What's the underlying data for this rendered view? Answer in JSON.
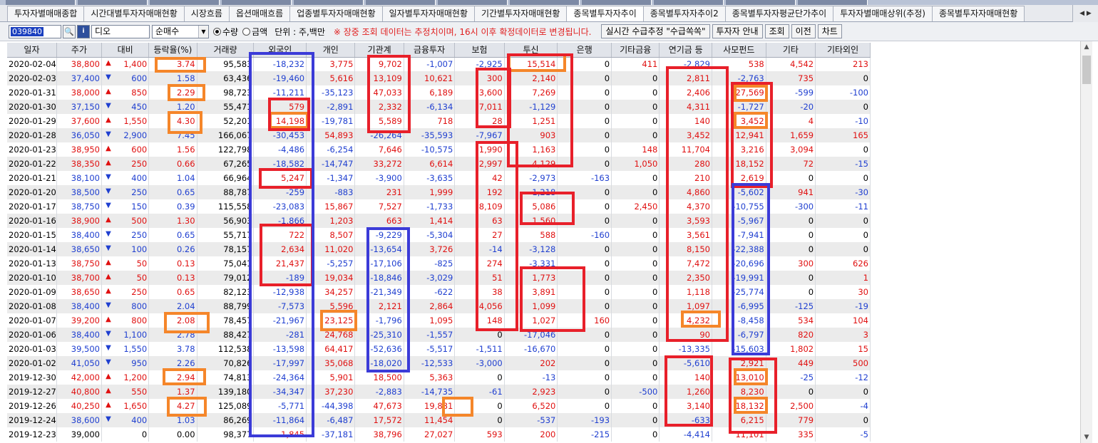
{
  "tabs": [
    "투자자별매매종합",
    "시간대별투자자매매현황",
    "시장흐름",
    "옵션매매흐름",
    "업종별투자자매매현황",
    "일자별투자자매매현황",
    "기간별투자자매매현황",
    "종목별투자자추이",
    "종목별투자자추이2",
    "종목별투자자평균단가추이",
    "투자자별매매상위(추정)",
    "종목별투자자매매현황"
  ],
  "toolbar": {
    "code": "039840",
    "name": "디오",
    "select": "순매수",
    "radio_qty": "수량",
    "radio_amt": "금액",
    "unit": "단위 : 주,백만",
    "notice": "※ 장중 조회 데이터는 추정치이며, 16시 이후 확정데이터로 변경됩니다.",
    "btn_realtime": "실시간 수급추정 \"수급쏙쏙\"",
    "btn_guide": "투자자 안내",
    "btn_query": "조회",
    "btn_prev": "이전",
    "btn_chart": "차트"
  },
  "headers": [
    "일자",
    "주가",
    "대비",
    "등락율(%)",
    "거래량",
    "외국인",
    "개인",
    "기관계",
    "금융투자",
    "보험",
    "투신",
    "은행",
    "기타금융",
    "연기금 등",
    "사모펀드",
    "기타",
    "기타외인"
  ],
  "rows": [
    [
      "2020-02-04",
      "38,800",
      "up",
      "1,400",
      "3.74",
      "95,583",
      "-18,232",
      "3,775",
      "9,702",
      "-1,007",
      "-2,925",
      "15,514",
      "0",
      "411",
      "-2,829",
      "538",
      "4,542",
      "213"
    ],
    [
      "2020-02-03",
      "37,400",
      "dn",
      "600",
      "1.58",
      "63,436",
      "-19,460",
      "5,616",
      "13,109",
      "10,621",
      "300",
      "2,140",
      "0",
      "0",
      "2,811",
      "-2,763",
      "735",
      "0"
    ],
    [
      "2020-01-31",
      "38,000",
      "up",
      "850",
      "2.29",
      "98,723",
      "-11,211",
      "-35,123",
      "47,033",
      "6,189",
      "3,600",
      "7,269",
      "0",
      "0",
      "2,406",
      "27,569",
      "-599",
      "-100"
    ],
    [
      "2020-01-30",
      "37,150",
      "dn",
      "450",
      "1.20",
      "55,471",
      "579",
      "-2,891",
      "2,332",
      "-6,134",
      "7,011",
      "-1,129",
      "0",
      "0",
      "4,311",
      "-1,727",
      "-20",
      "0"
    ],
    [
      "2020-01-29",
      "37,600",
      "up",
      "1,550",
      "4.30",
      "52,201",
      "14,198",
      "-19,781",
      "5,589",
      "718",
      "28",
      "1,251",
      "0",
      "0",
      "140",
      "3,452",
      "4",
      "-10"
    ],
    [
      "2020-01-28",
      "36,050",
      "dn",
      "2,900",
      "7.45",
      "166,067",
      "-30,453",
      "54,893",
      "-26,264",
      "-35,593",
      "-7,967",
      "903",
      "0",
      "0",
      "3,452",
      "12,941",
      "1,659",
      "165"
    ],
    [
      "2020-01-23",
      "38,950",
      "up",
      "600",
      "1.56",
      "122,798",
      "-4,486",
      "-6,254",
      "7,646",
      "-10,575",
      "1,990",
      "1,163",
      "0",
      "148",
      "11,704",
      "3,216",
      "3,094",
      "0"
    ],
    [
      "2020-01-22",
      "38,350",
      "up",
      "250",
      "0.66",
      "67,265",
      "-18,582",
      "-14,747",
      "33,272",
      "6,614",
      "2,997",
      "4,129",
      "0",
      "1,050",
      "280",
      "18,152",
      "72",
      "-15"
    ],
    [
      "2020-01-21",
      "38,100",
      "dn",
      "400",
      "1.04",
      "66,964",
      "5,247",
      "-1,347",
      "-3,900",
      "-3,635",
      "42",
      "-2,973",
      "-163",
      "0",
      "210",
      "2,619",
      "0",
      "0"
    ],
    [
      "2020-01-20",
      "38,500",
      "dn",
      "250",
      "0.65",
      "88,787",
      "-259",
      "-883",
      "231",
      "1,999",
      "192",
      "-1,218",
      "0",
      "0",
      "4,860",
      "-5,602",
      "941",
      "-30"
    ],
    [
      "2020-01-17",
      "38,750",
      "dn",
      "150",
      "0.39",
      "115,558",
      "-23,083",
      "15,867",
      "7,527",
      "-1,733",
      "8,109",
      "5,086",
      "0",
      "2,450",
      "4,370",
      "-10,755",
      "-300",
      "-11"
    ],
    [
      "2020-01-16",
      "38,900",
      "up",
      "500",
      "1.30",
      "56,903",
      "-1,866",
      "1,203",
      "663",
      "1,414",
      "63",
      "1,560",
      "0",
      "0",
      "3,593",
      "-5,967",
      "0",
      "0"
    ],
    [
      "2020-01-15",
      "38,400",
      "dn",
      "250",
      "0.65",
      "55,717",
      "722",
      "8,507",
      "-9,229",
      "-5,304",
      "27",
      "588",
      "-160",
      "0",
      "3,561",
      "-7,941",
      "0",
      "0"
    ],
    [
      "2020-01-14",
      "38,650",
      "dn",
      "100",
      "0.26",
      "78,157",
      "2,634",
      "11,020",
      "-13,654",
      "3,726",
      "-14",
      "-3,128",
      "0",
      "0",
      "8,150",
      "-22,388",
      "0",
      "0"
    ],
    [
      "2020-01-13",
      "38,750",
      "up",
      "50",
      "0.13",
      "75,041",
      "21,437",
      "-5,257",
      "-17,106",
      "-825",
      "274",
      "-3,331",
      "0",
      "0",
      "7,472",
      "-20,696",
      "300",
      "626"
    ],
    [
      "2020-01-10",
      "38,700",
      "up",
      "50",
      "0.13",
      "79,012",
      "-189",
      "19,034",
      "-18,846",
      "-3,029",
      "51",
      "1,773",
      "0",
      "0",
      "2,350",
      "-19,991",
      "0",
      "1"
    ],
    [
      "2020-01-09",
      "38,650",
      "up",
      "250",
      "0.65",
      "82,123",
      "-12,938",
      "34,257",
      "-21,349",
      "-622",
      "38",
      "3,891",
      "0",
      "0",
      "1,118",
      "-25,774",
      "0",
      "30"
    ],
    [
      "2020-01-08",
      "38,400",
      "dn",
      "800",
      "2.04",
      "88,799",
      "-7,573",
      "5,596",
      "2,121",
      "2,864",
      "4,056",
      "1,099",
      "0",
      "0",
      "1,097",
      "-6,995",
      "-125",
      "-19"
    ],
    [
      "2020-01-07",
      "39,200",
      "up",
      "800",
      "2.08",
      "78,457",
      "-21,967",
      "23,125",
      "-1,796",
      "1,095",
      "148",
      "1,027",
      "160",
      "0",
      "4,232",
      "-8,458",
      "534",
      "104"
    ],
    [
      "2020-01-06",
      "38,400",
      "dn",
      "1,100",
      "2.78",
      "88,427",
      "-281",
      "24,768",
      "-25,310",
      "-1,557",
      "0",
      "-17,046",
      "0",
      "0",
      "90",
      "-6,797",
      "820",
      "3"
    ],
    [
      "2020-01-03",
      "39,500",
      "dn",
      "1,550",
      "3.78",
      "112,538",
      "-13,598",
      "64,417",
      "-52,636",
      "-5,517",
      "-1,511",
      "-16,670",
      "0",
      "0",
      "-13,335",
      "-15,603",
      "1,802",
      "15"
    ],
    [
      "2020-01-02",
      "41,050",
      "dn",
      "950",
      "2.26",
      "70,826",
      "-17,997",
      "35,068",
      "-18,020",
      "-12,533",
      "-3,000",
      "202",
      "0",
      "0",
      "-5,610",
      "2,921",
      "449",
      "500"
    ],
    [
      "2019-12-30",
      "42,000",
      "up",
      "1,200",
      "2.94",
      "74,813",
      "-24,364",
      "5,901",
      "18,500",
      "5,363",
      "0",
      "-13",
      "0",
      "0",
      "140",
      "13,010",
      "-25",
      "-12"
    ],
    [
      "2019-12-27",
      "40,800",
      "up",
      "550",
      "1.37",
      "139,180",
      "-34,347",
      "37,230",
      "-2,883",
      "-14,735",
      "-61",
      "2,923",
      "0",
      "-500",
      "1,260",
      "8,230",
      "0",
      "0"
    ],
    [
      "2019-12-26",
      "40,250",
      "up",
      "1,650",
      "4.27",
      "125,089",
      "-5,771",
      "-44,398",
      "47,673",
      "19,881",
      "0",
      "6,520",
      "0",
      "0",
      "3,140",
      "18,132",
      "2,500",
      "-4"
    ],
    [
      "2019-12-24",
      "38,600",
      "dn",
      "400",
      "1.03",
      "86,269",
      "-11,864",
      "-6,487",
      "17,572",
      "11,454",
      "0",
      "-537",
      "-193",
      "0",
      "-633",
      "6,215",
      "779",
      "0"
    ],
    [
      "2019-12-23",
      "39,000",
      "",
      "0",
      "0.00",
      "98,377",
      "1,845",
      "-37,181",
      "38,796",
      "27,027",
      "593",
      "200",
      "-215",
      "0",
      "-4,414",
      "11,101",
      "335",
      "-5"
    ]
  ],
  "colors": {
    "red": "#e01010",
    "blue": "#1f3fd0",
    "box_red": "#e8202a",
    "box_blue": "#3b3bd8",
    "box_orange": "#f5862a",
    "header_bg": "#e1e4ea",
    "stripe": "#ebebeb"
  }
}
